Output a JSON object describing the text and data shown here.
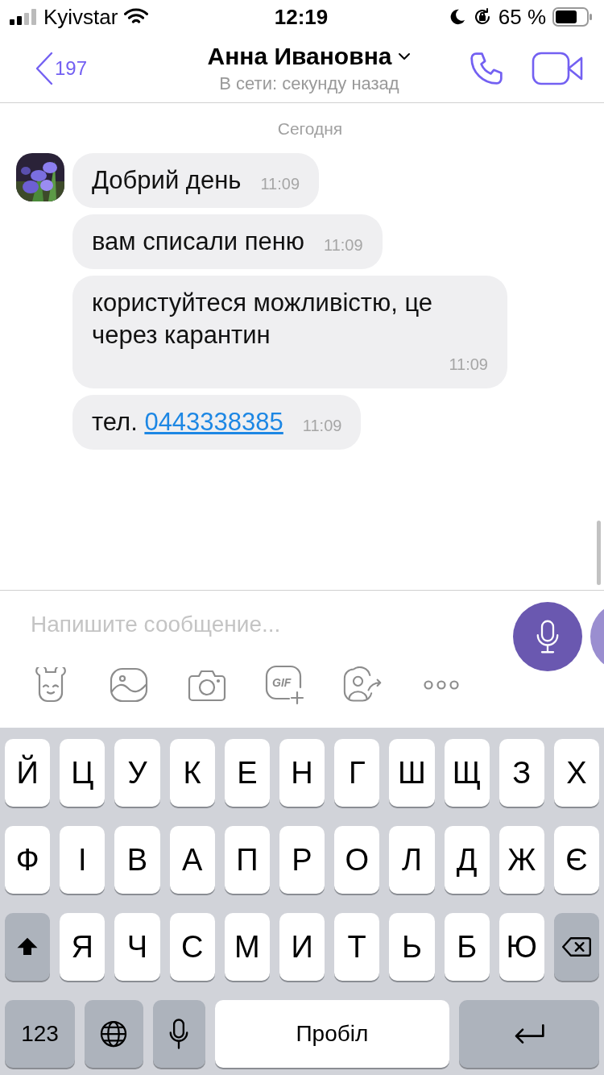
{
  "status_bar": {
    "carrier": "Kyivstar",
    "time": "12:19",
    "battery": "65 %"
  },
  "header": {
    "back_count": "197",
    "title": "Анна Ивановна",
    "subtitle": "В сети: секунду назад"
  },
  "chat": {
    "date": "Сегодня",
    "messages": [
      {
        "text": "Добрий день",
        "time": "11:09",
        "avatar": true
      },
      {
        "text": "вам списали пеню",
        "time": "11:09",
        "avatar": false
      },
      {
        "text": "користуйтеся можливістю, це через карантин",
        "time": "11:09",
        "avatar": false
      },
      {
        "text": "тел.",
        "link": "0443338385",
        "time": "11:09",
        "avatar": false
      }
    ]
  },
  "composer": {
    "placeholder": "Напишите сообщение...",
    "gif_label": "GIF"
  },
  "keyboard": {
    "letter_rows": [
      {
        "keys": [
          {
            "kind": "letter",
            "label": "Й"
          },
          {
            "kind": "letter",
            "label": "Ц"
          },
          {
            "kind": "letter",
            "label": "У"
          },
          {
            "kind": "letter",
            "label": "К"
          },
          {
            "kind": "letter",
            "label": "Е"
          },
          {
            "kind": "letter",
            "label": "Н"
          },
          {
            "kind": "letter",
            "label": "Г"
          },
          {
            "kind": "letter",
            "label": "Ш"
          },
          {
            "kind": "letter",
            "label": "Щ"
          },
          {
            "kind": "letter",
            "label": "З"
          },
          {
            "kind": "letter",
            "label": "Х"
          }
        ]
      },
      {
        "keys": [
          {
            "kind": "letter",
            "label": "Ф"
          },
          {
            "kind": "letter",
            "label": "І"
          },
          {
            "kind": "letter",
            "label": "В"
          },
          {
            "kind": "letter",
            "label": "А"
          },
          {
            "kind": "letter",
            "label": "П"
          },
          {
            "kind": "letter",
            "label": "Р"
          },
          {
            "kind": "letter",
            "label": "О"
          },
          {
            "kind": "letter",
            "label": "Л"
          },
          {
            "kind": "letter",
            "label": "Д"
          },
          {
            "kind": "letter",
            "label": "Ж"
          },
          {
            "kind": "letter",
            "label": "Є"
          }
        ]
      },
      {
        "keys": [
          {
            "kind": "shift"
          },
          {
            "kind": "letter",
            "label": "Я"
          },
          {
            "kind": "letter",
            "label": "Ч"
          },
          {
            "kind": "letter",
            "label": "С"
          },
          {
            "kind": "letter",
            "label": "М"
          },
          {
            "kind": "letter",
            "label": "И"
          },
          {
            "kind": "letter",
            "label": "Т"
          },
          {
            "kind": "letter",
            "label": "Ь"
          },
          {
            "kind": "letter",
            "label": "Б"
          },
          {
            "kind": "letter",
            "label": "Ю"
          },
          {
            "kind": "backspace"
          }
        ]
      }
    ],
    "bottom_row": {
      "keys": [
        {
          "kind": "numbers",
          "label": "123"
        },
        {
          "kind": "globe"
        },
        {
          "kind": "mic"
        },
        {
          "kind": "space",
          "label": "Пробіл"
        },
        {
          "kind": "return"
        }
      ]
    }
  }
}
